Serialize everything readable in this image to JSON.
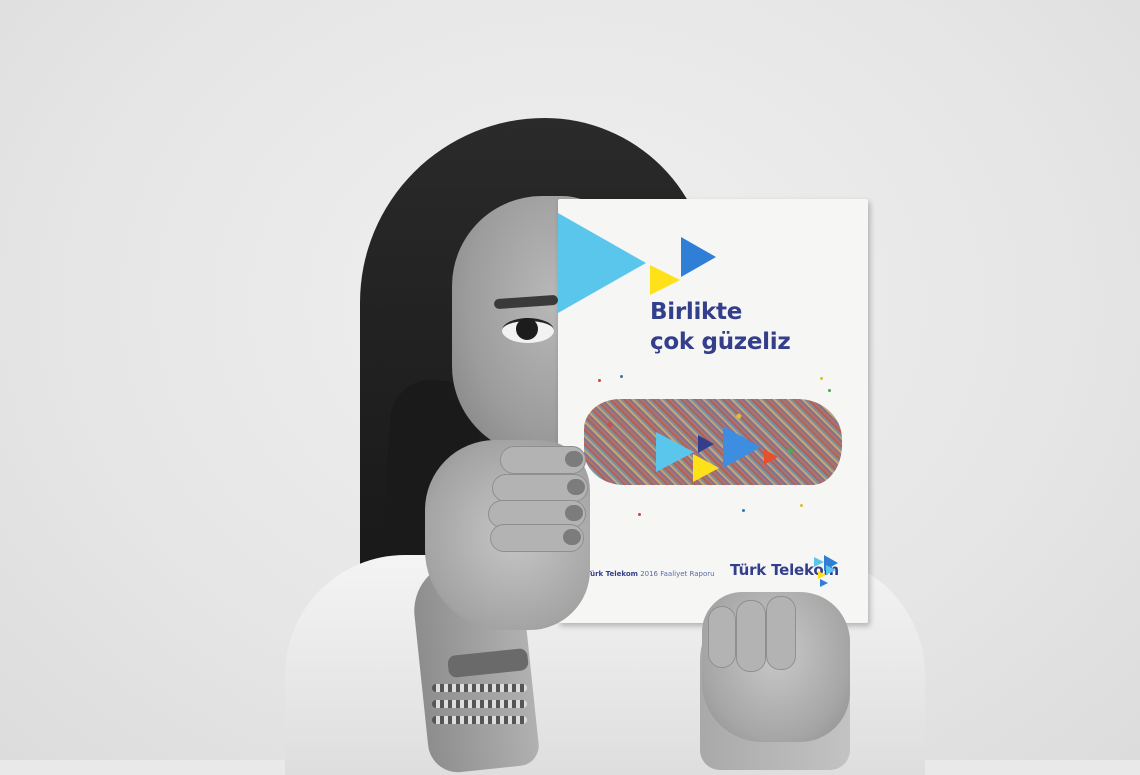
{
  "booklet": {
    "headline_line1": "Birlikte",
    "headline_line2": "çok güzeliz",
    "footer_brand": "Türk Telekom",
    "footer_year": "2016",
    "footer_report": "Faaliyet Raporu",
    "brand_wordmark": "Türk Telekom"
  },
  "colors": {
    "navy": "#343f8c",
    "light_blue": "#5bc6ec",
    "blue": "#2f7fd6",
    "yellow": "#ffe11a",
    "orange": "#e8502b"
  },
  "icons": [
    "turk-telekom-logo-icon",
    "play-triangle-icon"
  ]
}
